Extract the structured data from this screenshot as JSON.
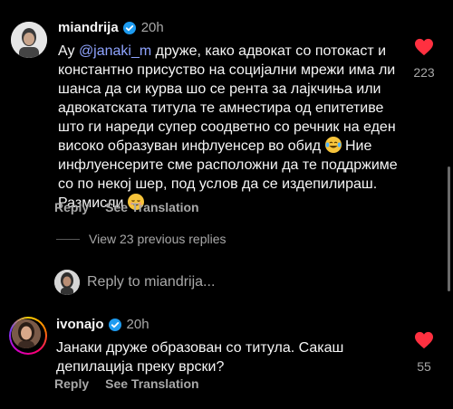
{
  "comments": [
    {
      "username": "miandrija",
      "time": "20h",
      "mention": "@janaki_m",
      "text_before": "Ау ",
      "text_after": " друже, како адвокат со потокаст и константно присуство на социјални мрежи има ли шанса да си курва шо се рента за лајкчиња или адвокатската титула те амнестира од епитетиве што ги нареди супер соодветно со речник на еден високо образуван инфлуенсер во обид ",
      "text_after2": " Ние инфлуенсерите сме расположни да те поддржиме со по некој шер, под услов да се издепилираш. Размисли ",
      "emoji1": "tears-of-joy-emoji",
      "emoji2": "relieved-face-emoji",
      "reply_label": "Reply",
      "translate_label": "See Translation",
      "likes": "223",
      "view_replies": "View 23 previous replies",
      "reply_to_placeholder": "Reply to miandrija..."
    },
    {
      "username": "ivonajo",
      "time": "20h",
      "text": "Јанаки друже образован со титула. Сакаш депилација преку врски?",
      "reply_label": "Reply",
      "translate_label": "See Translation",
      "likes": "55"
    }
  ],
  "colors": {
    "background": "#000000",
    "heart": "#ff3040",
    "verified": "#1d9bf0",
    "mention": "#8fa4ff",
    "secondary_text": "#a8a8a8"
  }
}
